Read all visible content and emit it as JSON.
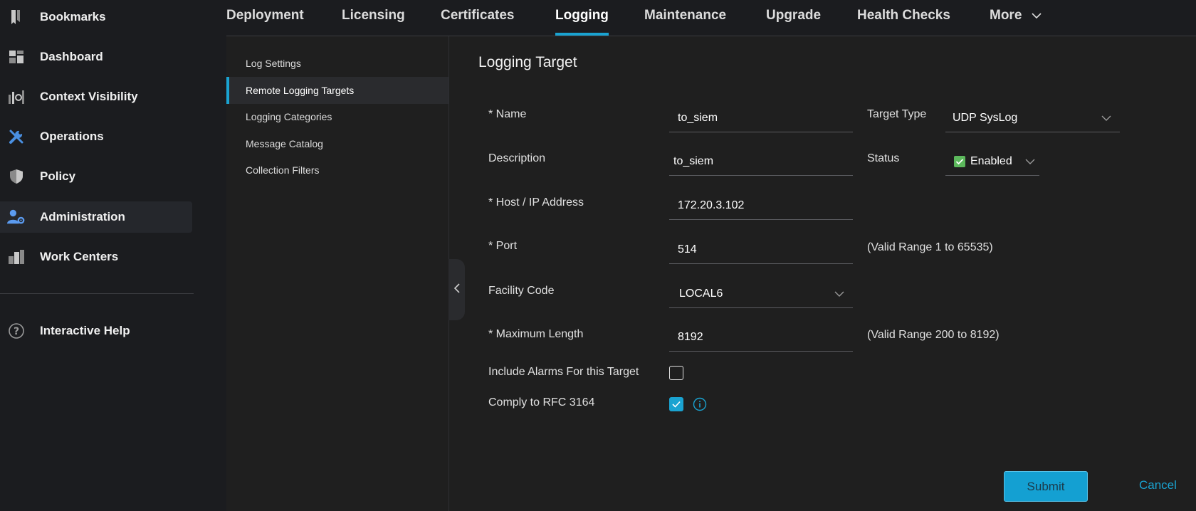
{
  "nav": {
    "items": [
      {
        "label": "Bookmarks",
        "icon": "bookmark-icon"
      },
      {
        "label": "Dashboard",
        "icon": "dashboard-icon"
      },
      {
        "label": "Context Visibility",
        "icon": "context-visibility-icon"
      },
      {
        "label": "Operations",
        "icon": "wrench-icon"
      },
      {
        "label": "Policy",
        "icon": "shield-icon"
      },
      {
        "label": "Administration",
        "icon": "admin-user-gear-icon",
        "active": true
      },
      {
        "label": "Work Centers",
        "icon": "buildings-icon"
      }
    ],
    "help": {
      "label": "Interactive Help",
      "icon": "question-circle-icon"
    }
  },
  "tabs": [
    {
      "label": "Deployment"
    },
    {
      "label": "Licensing"
    },
    {
      "label": "Certificates"
    },
    {
      "label": "Logging",
      "active": true
    },
    {
      "label": "Maintenance"
    },
    {
      "label": "Upgrade"
    },
    {
      "label": "Health Checks"
    },
    {
      "label": "More"
    }
  ],
  "submenu": [
    {
      "label": "Log Settings"
    },
    {
      "label": "Remote Logging Targets",
      "active": true
    },
    {
      "label": "Logging Categories"
    },
    {
      "label": "Message Catalog"
    },
    {
      "label": "Collection Filters"
    }
  ],
  "form": {
    "title": "Logging Target",
    "name": {
      "label": "* Name",
      "value": "to_siem"
    },
    "description": {
      "label": "Description",
      "value": "to_siem"
    },
    "host": {
      "label": "* Host / IP Address",
      "value": "172.20.3.102"
    },
    "port": {
      "label": "* Port",
      "value": "514",
      "hint": "(Valid Range 1 to 65535)"
    },
    "facility": {
      "label": "Facility Code",
      "value": "LOCAL6"
    },
    "max_length": {
      "label": "* Maximum Length",
      "value": "8192",
      "hint": "(Valid Range 200 to 8192)"
    },
    "target_type": {
      "label": "Target Type",
      "value": "UDP SysLog"
    },
    "status": {
      "label": "Status",
      "value": "Enabled"
    },
    "include_alarms": {
      "label": "Include Alarms For this Target",
      "checked": false
    },
    "rfc3164": {
      "label": "Comply to RFC 3164",
      "checked": true
    },
    "submit_label": "Submit",
    "cancel_label": "Cancel"
  },
  "colors": {
    "accent": "#1aa3d1",
    "status_green": "#5cb85c"
  }
}
